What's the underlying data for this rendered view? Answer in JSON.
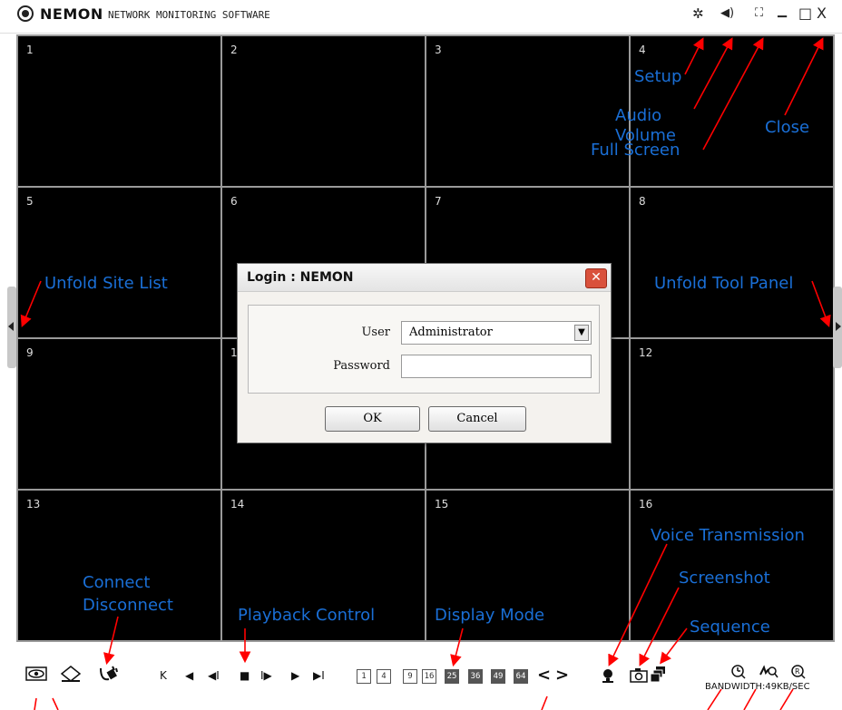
{
  "app": {
    "brand": "NEMON",
    "subtitle": "NETWORK MONITORING SOFTWARE"
  },
  "titlebar_icons": {
    "setup": "✲",
    "audio": "◀)",
    "fullscreen": "⛶",
    "minimize": "▁",
    "maximize": "□",
    "close": "X"
  },
  "cells": [
    "1",
    "2",
    "3",
    "4",
    "5",
    "6",
    "7",
    "8",
    "9",
    "1",
    "11",
    "12",
    "13",
    "14",
    "15",
    "16"
  ],
  "labels": {
    "setup": "Setup",
    "audio_volume": "Audio\nVolume",
    "full_screen": "Full Screen",
    "close": "Close",
    "unfold_site_list": "Unfold Site List",
    "unfold_tool_panel": "Unfold Tool Panel",
    "voice_transmission": "Voice Transmission",
    "screenshot": "Screenshot",
    "sequence": "Sequence",
    "connect_disconnect": "Connect\nDisconnect",
    "playback_control": "Playback Control",
    "display_mode": "Display Mode"
  },
  "toolbar": {
    "playback": [
      "K",
      "◀",
      "◀I",
      "■",
      "I▶",
      "▶",
      "▶I"
    ],
    "modes": [
      "1",
      "4",
      "9",
      "16",
      "25",
      "36",
      "49",
      "64"
    ],
    "page_prev": "<",
    "page_next": ">",
    "bandwidth": "BANDWIDTH:49KB/SEC"
  },
  "dialog": {
    "title": "Login : NEMON",
    "user_label": "User",
    "user_value": "Administrator",
    "password_label": "Password",
    "ok": "OK",
    "cancel": "Cancel"
  },
  "colors": {
    "annotation": "#2a7be0",
    "arrow": "#ff0000"
  }
}
